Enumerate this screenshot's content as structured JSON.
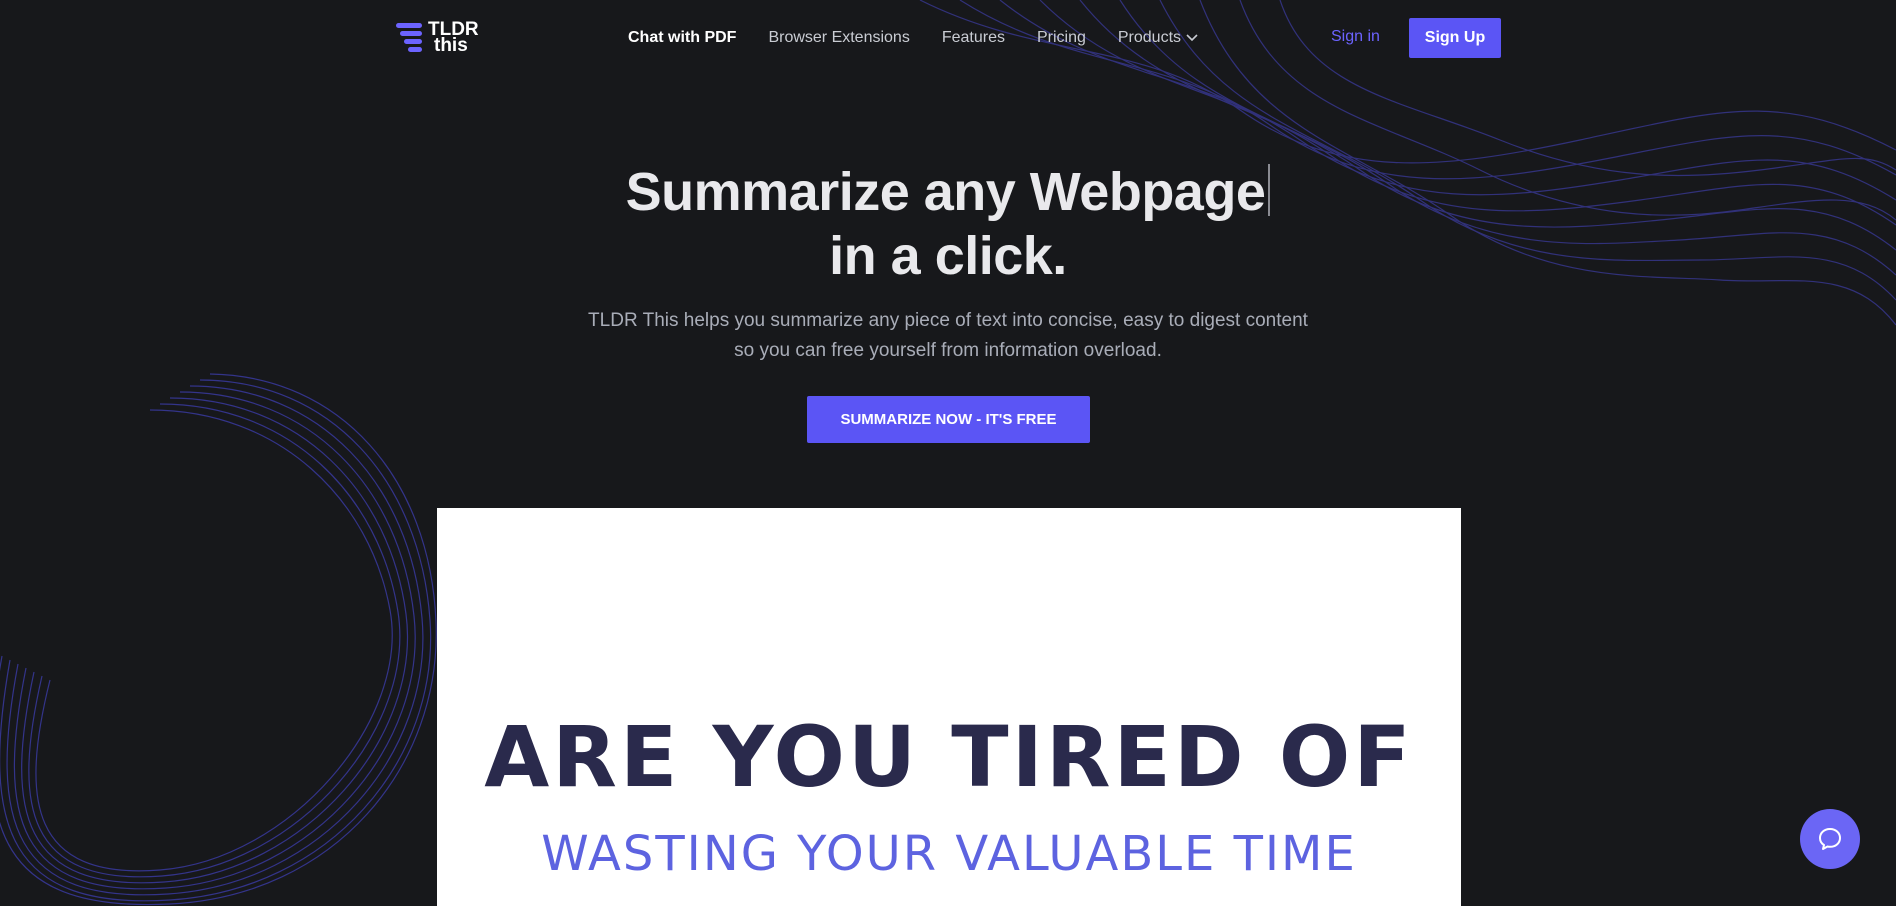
{
  "brand": {
    "logo_line1": "TLDR",
    "logo_line2": "this",
    "accent": "#5b55f5"
  },
  "nav": {
    "items": [
      {
        "label": "Chat with PDF",
        "active": true
      },
      {
        "label": "Browser Extensions"
      },
      {
        "label": "Features"
      },
      {
        "label": "Pricing"
      },
      {
        "label": "Products",
        "icon": "chevron-down-icon"
      }
    ],
    "sign_in": "Sign in",
    "sign_up": "Sign Up"
  },
  "hero": {
    "title_line1": "Summarize any Webpage",
    "title_line2": "in a click.",
    "subtitle_line1": "TLDR This helps you summarize any piece of text into concise, easy to digest content",
    "subtitle_line2": "so you can free yourself from information overload.",
    "cta_label": "SUMMARIZE NOW - IT'S FREE"
  },
  "promo": {
    "line1": "ARE YOU TIRED OF",
    "line2": "WASTING YOUR VALUABLE TIME"
  },
  "chat_widget": {
    "icon": "chat-bubble-icon"
  }
}
